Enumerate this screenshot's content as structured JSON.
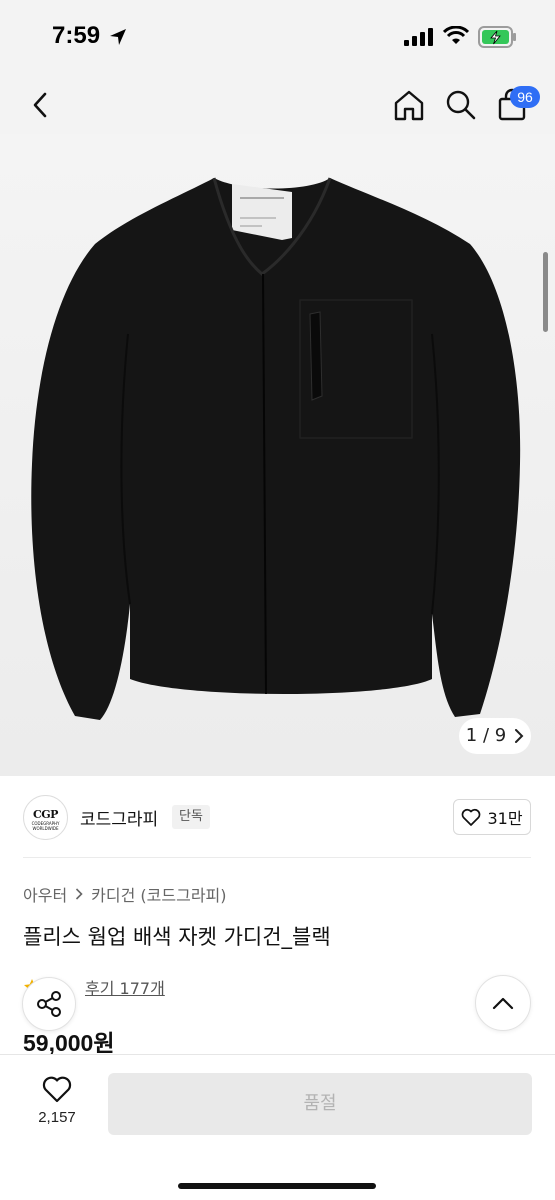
{
  "status_bar": {
    "time": "7:59"
  },
  "nav": {
    "cart_count": "96"
  },
  "gallery": {
    "current": "1",
    "separator": "/",
    "total": "9"
  },
  "brand": {
    "logo_text": "CGP",
    "logo_subtext": "CODEGRAPHY WORLDWIDE",
    "name": "코드그라피",
    "badge": "단독",
    "likes": "31만"
  },
  "breadcrumb": {
    "category": "아우터",
    "subcategory": "카디건 (코드그라피)"
  },
  "product": {
    "title": "플리스 웜업 배색 자켓 가디건_블랙",
    "review_label": "후기 177개",
    "price": "59,000원"
  },
  "bottom": {
    "wish_count": "2,157",
    "buy_label": "품절"
  },
  "colors": {
    "accent": "#2f6ef5",
    "jacket": "#161616",
    "disabled_bg": "#e9e9e9"
  },
  "icons": [
    "location-arrow-icon",
    "signal-icon",
    "wifi-icon",
    "battery-charging-icon",
    "back-chevron-icon",
    "home-icon",
    "search-icon",
    "shopping-bag-icon",
    "chevron-right-icon",
    "heart-icon",
    "star-icon",
    "share-icon",
    "chevron-up-icon"
  ]
}
